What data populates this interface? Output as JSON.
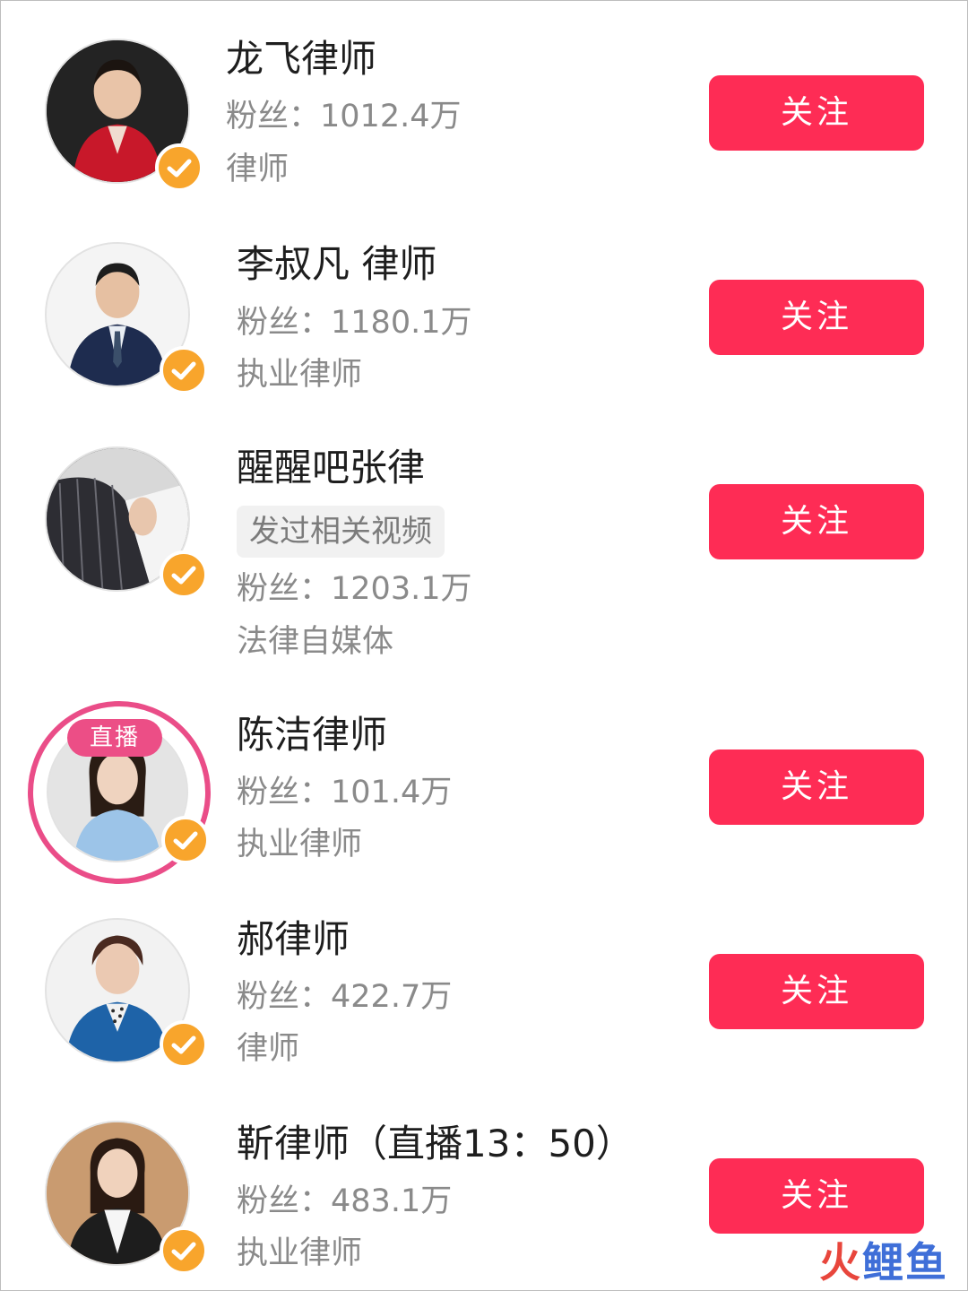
{
  "colors": {
    "follow_button": "#fe2c55",
    "verified_badge": "#f8a52c",
    "live_ring": "#ea4d88"
  },
  "results": [
    {
      "name": "龙飞律师",
      "fans_label": "粉丝：",
      "fans_value": "1012.4万",
      "description": "律师",
      "follow_label": "关注",
      "verified": true,
      "avatar_icon": "woman-red-suit-avatar"
    },
    {
      "name": "李叔凡 律师",
      "fans_label": "粉丝：",
      "fans_value": "1180.1万",
      "description": "执业律师",
      "follow_label": "关注",
      "verified": true,
      "avatar_icon": "man-navy-suit-avatar"
    },
    {
      "name": "醒醒吧张律",
      "tag": "发过相关视频",
      "fans_label": "粉丝：",
      "fans_value": "1203.1万",
      "description": "法律自媒体",
      "follow_label": "关注",
      "verified": true,
      "avatar_icon": "man-pinstripe-suit-avatar"
    },
    {
      "name": "陈洁律师",
      "live_badge": "直播",
      "fans_label": "粉丝：",
      "fans_value": "101.4万",
      "description": "执业律师",
      "follow_label": "关注",
      "verified": true,
      "avatar_icon": "woman-blue-blouse-avatar"
    },
    {
      "name": "郝律师",
      "fans_label": "粉丝：",
      "fans_value": "422.7万",
      "description": "律师",
      "follow_label": "关注",
      "verified": true,
      "avatar_icon": "woman-blue-jacket-avatar"
    },
    {
      "name": "靳律师（直播13：50）",
      "fans_label": "粉丝：",
      "fans_value": "483.1万",
      "description": "执业律师",
      "follow_label": "关注",
      "verified": true,
      "avatar_icon": "woman-black-blazer-avatar"
    }
  ],
  "watermark": {
    "part1": "火",
    "part2": "鲤鱼"
  }
}
